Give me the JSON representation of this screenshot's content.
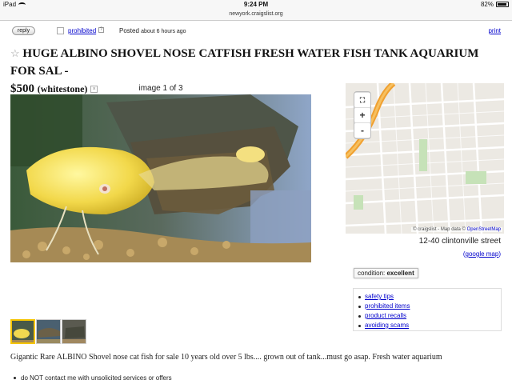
{
  "status_bar": {
    "device": "iPad",
    "time": "9:24 PM",
    "battery": "82%"
  },
  "browser": {
    "url": "newyork.craigslist.org"
  },
  "actions": {
    "reply_label": "reply",
    "prohibited_label": "prohibited",
    "help_glyph": "?",
    "posted_label": "Posted",
    "posted_ago": "about 6 hours ago",
    "print_label": "print"
  },
  "posting": {
    "star": "☆",
    "title": "HUGE ALBINO SHOVEL NOSE CATFISH FRESH WATER FISH TANK AQUARIUM FOR SAL -",
    "price": "$500",
    "location": "(whitestone)",
    "hide_glyph": "×"
  },
  "gallery": {
    "counter": "image 1 of 3",
    "thumbnail_count": 3,
    "selected_index": 1
  },
  "map": {
    "zoom_in": "+",
    "zoom_out": "-",
    "attribution_prefix": "© craigslist - Map data ©",
    "attribution_link": "OpenStreetMap",
    "street": "12-40 clintonville street",
    "google_map_open": "(",
    "google_map_label": "google map",
    "google_map_close": ")"
  },
  "attributes": {
    "condition_label": "condition:",
    "condition_value": "excellent"
  },
  "links": [
    {
      "label": "safety tips"
    },
    {
      "label": "prohibited items"
    },
    {
      "label": "product recalls"
    },
    {
      "label": "avoiding scams"
    }
  ],
  "body": {
    "description": "Gigantic Rare ALBINO Shovel nose cat fish for sale 10 years old over 5 lbs.... grown out of tank...must go asap. Fresh water aquarium",
    "notice": "do NOT contact me with unsolicited services or offers"
  },
  "colors": {
    "link": "#0000cc",
    "thumb_selected": "#f5c400",
    "map_highway": "#f0a030"
  }
}
